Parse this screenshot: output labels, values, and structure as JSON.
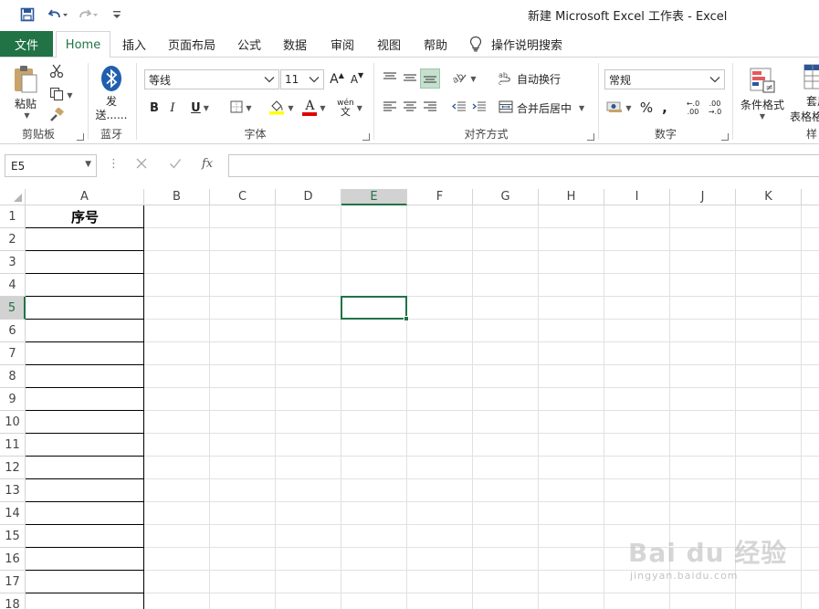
{
  "window": {
    "title": "新建 Microsoft Excel 工作表  -  Excel"
  },
  "quick_access": {
    "save_icon": "save-icon",
    "undo_icon": "undo-icon",
    "redo_icon": "redo-icon",
    "customize_icon": "customize-qat-icon"
  },
  "tabs": [
    {
      "label": "文件"
    },
    {
      "label": "Home"
    },
    {
      "label": "插入"
    },
    {
      "label": "页面布局"
    },
    {
      "label": "公式"
    },
    {
      "label": "数据"
    },
    {
      "label": "审阅"
    },
    {
      "label": "视图"
    },
    {
      "label": "帮助"
    }
  ],
  "tell_me": {
    "label": "操作说明搜索"
  },
  "ribbon": {
    "clipboard": {
      "label": "剪贴板",
      "paste_label": "粘贴"
    },
    "bluetooth": {
      "label": "蓝牙",
      "send_label_1": "发",
      "send_label_2": "送......"
    },
    "font": {
      "label": "字体",
      "font_name": "等线",
      "font_size": "11",
      "bold": "B",
      "italic": "I",
      "underline": "U",
      "grow": "A",
      "shrink": "A",
      "phonetic_top": "wén",
      "phonetic_bottom": "文",
      "font_color": "A"
    },
    "alignment": {
      "label": "对齐方式",
      "wrap_text": "自动换行",
      "merge_center": "合并后居中"
    },
    "number": {
      "label": "数字",
      "format": "常规",
      "percent": "%",
      "comma": ",",
      "inc_dec_top": "←.0",
      "inc_dec_bottom": ".00",
      "dec_dec_top": ".00",
      "dec_dec_bottom": "→.0"
    },
    "styles": {
      "label": "样",
      "conditional_format": "条件格式",
      "table_format_1": "套用",
      "table_format_2": "表格格"
    }
  },
  "formula_bar": {
    "name_box": "E5",
    "fx": "fx",
    "value": ""
  },
  "sheet": {
    "columns": [
      "A",
      "B",
      "C",
      "D",
      "E",
      "F",
      "G",
      "H",
      "I",
      "J",
      "K"
    ],
    "rows": [
      "1",
      "2",
      "3",
      "4",
      "5",
      "6",
      "7",
      "8",
      "9",
      "10",
      "11",
      "12",
      "13",
      "14",
      "15",
      "16",
      "17",
      "18"
    ],
    "cells": {
      "A1": "序号"
    },
    "active_cell": "E5",
    "accent_color": "#217346"
  },
  "watermark": {
    "brand": "Bai du 经验",
    "url": "jingyan.baidu.com"
  }
}
